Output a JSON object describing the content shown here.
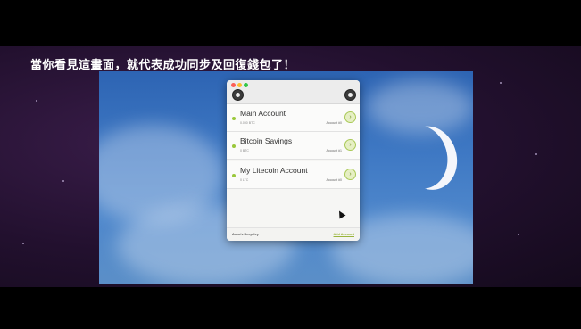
{
  "caption": "當你看見這畫面，就代表成功同步及回復錢包了！",
  "window": {
    "traffic_lights": [
      "red",
      "yellow",
      "green"
    ],
    "left_icon": "gear-icon",
    "right_icon": "gear-icon"
  },
  "accounts": [
    {
      "name": "Main Account",
      "balance": "0.000 BTC",
      "number": "Account #0"
    },
    {
      "name": "Bitcoin Savings",
      "balance": "0 BTC",
      "number": "Account #1"
    },
    {
      "name": "My Litecoin Account",
      "balance": "0 LTC",
      "number": "Account #0"
    }
  ],
  "footer": {
    "owner": "Anna's KeepKey",
    "add_account": "Add Account"
  },
  "colors": {
    "accent": "#9ac83b",
    "wallpaper": "#3f79c4",
    "stage": "#22102e"
  }
}
